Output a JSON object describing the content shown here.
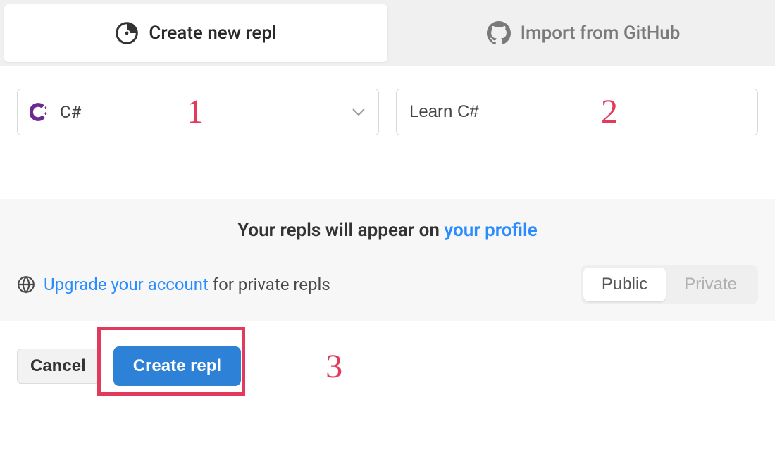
{
  "tabs": {
    "create": "Create new repl",
    "import": "Import from GitHub"
  },
  "language": {
    "name": "C#"
  },
  "repl_name": "Learn C#",
  "annotations": {
    "one": "1",
    "two": "2",
    "three": "3"
  },
  "info": {
    "prefix": "Your repls will appear on ",
    "link": "your profile"
  },
  "upgrade": {
    "link": "Upgrade your account",
    "suffix": " for private repls"
  },
  "toggles": {
    "public": "Public",
    "private": "Private"
  },
  "buttons": {
    "cancel": "Cancel",
    "create": "Create repl"
  }
}
